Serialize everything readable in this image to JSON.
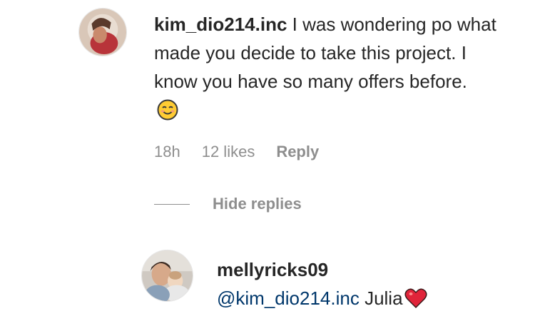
{
  "comment": {
    "username": "kim_dio214.inc",
    "text": "I was wondering po what made you decide to take this project. I know you have so many offers before.",
    "time": "18h",
    "likes": "12 likes",
    "reply_label": "Reply",
    "emoji_icon": "smiling-face-emoji"
  },
  "replies_toggle": {
    "label": "Hide replies"
  },
  "reply": {
    "username": "mellyricks09",
    "mention": "@kim_dio214.inc",
    "text": "Julia",
    "emoji_icon": "red-heart-emoji"
  },
  "colors": {
    "text": "#262626",
    "secondary": "#8e8e8e",
    "mention": "#00376b",
    "heart": "#e0243a"
  }
}
